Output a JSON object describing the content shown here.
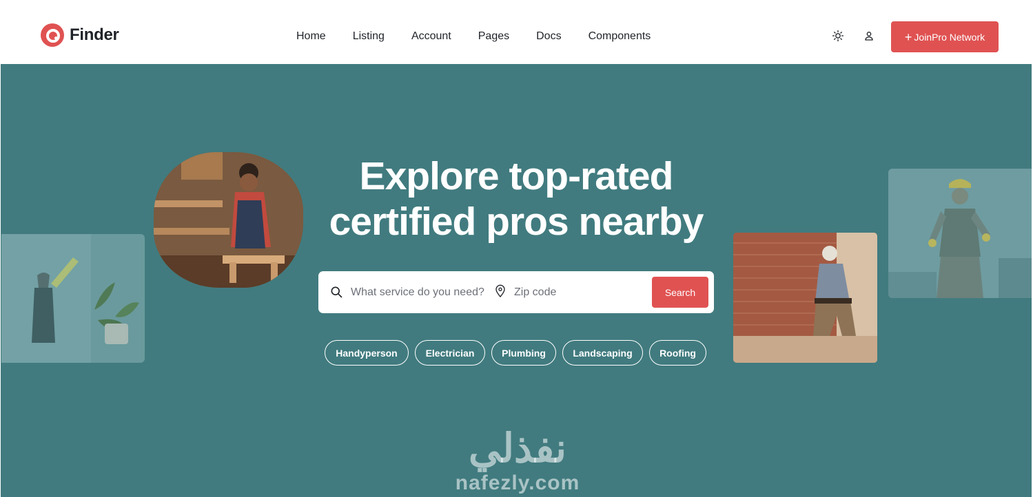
{
  "brand": {
    "name": "Finder"
  },
  "nav": {
    "items": [
      {
        "label": "Home"
      },
      {
        "label": "Listing"
      },
      {
        "label": "Account"
      },
      {
        "label": "Pages"
      },
      {
        "label": "Docs"
      },
      {
        "label": "Components"
      }
    ]
  },
  "header": {
    "theme_icon": "sun-icon",
    "account_icon": "user-icon",
    "join_button": {
      "icon": "plus-icon",
      "label": "JoinPro Network"
    }
  },
  "hero": {
    "title_line1": "Explore top-rated",
    "title_line2": "certified pros nearby",
    "search": {
      "service_placeholder": "What service do you need?",
      "service_value": "",
      "zip_placeholder": "Zip code",
      "zip_value": "",
      "button_label": "Search"
    },
    "categories": [
      {
        "label": "Handyperson"
      },
      {
        "label": "Electrician"
      },
      {
        "label": "Plumbing"
      },
      {
        "label": "Landscaping"
      },
      {
        "label": "Roofing"
      }
    ]
  },
  "watermark": {
    "arabic": "نفذلي",
    "latin": "nafezly.com"
  },
  "colors": {
    "accent": "#e05252",
    "hero_bg": "#417b7f",
    "text": "#1f2328"
  }
}
